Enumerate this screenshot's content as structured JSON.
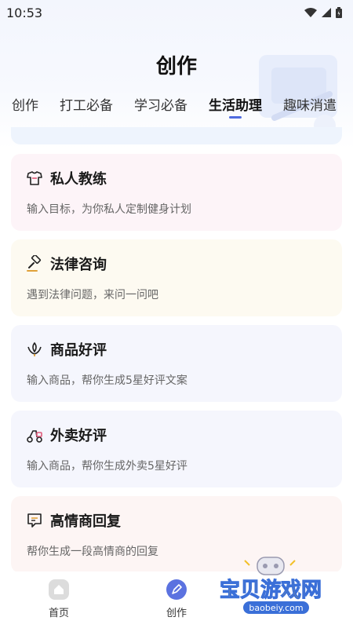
{
  "status_bar": {
    "time": "10:53"
  },
  "page_title": "创作",
  "tabs": [
    {
      "label": "创作",
      "active": false
    },
    {
      "label": "打工必备",
      "active": false
    },
    {
      "label": "学习必备",
      "active": false
    },
    {
      "label": "生活助理",
      "active": true
    },
    {
      "label": "趣味消遣",
      "active": false
    }
  ],
  "cards": [
    {
      "title": "私人教练",
      "desc": "输入目标，为你私人定制健身计划",
      "icon": "fitness-shirt-icon",
      "bg": "#fdf4f8"
    },
    {
      "title": "法律咨询",
      "desc": "遇到法律问题，来问一问吧",
      "icon": "gavel-icon",
      "bg": "#fdfaf1"
    },
    {
      "title": "商品好评",
      "desc": "输入商品，帮你生成5星好评文案",
      "icon": "lotus-icon",
      "bg": "#f5f6fd"
    },
    {
      "title": "外卖好评",
      "desc": "输入商品，帮你生成外卖5星好评",
      "icon": "scooter-icon",
      "bg": "#f5f6fd"
    },
    {
      "title": "高情商回复",
      "desc": "帮你生成一段高情商的回复",
      "icon": "chat-bubble-icon",
      "bg": "#fdf5f4"
    }
  ],
  "bottom_nav": [
    {
      "label": "首页",
      "icon": "home-icon",
      "active": false
    },
    {
      "label": "创作",
      "icon": "pen-icon",
      "active": true
    }
  ],
  "watermark": {
    "title": "宝贝游戏网",
    "url": "baobeiy.com"
  },
  "colors": {
    "accent": "#4f6bdf"
  }
}
